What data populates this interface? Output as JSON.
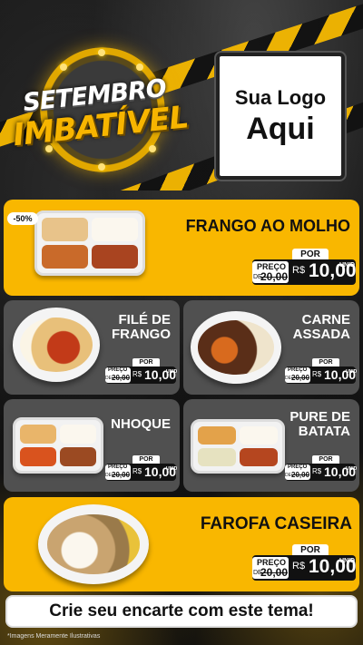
{
  "header": {
    "badge_line1": "SETEMBRO",
    "badge_line2": "IMBATÍVEL",
    "logo_line1": "Sua Logo",
    "logo_line2": "Aqui"
  },
  "price_common": {
    "por": "POR",
    "preco": "PREÇO",
    "de": "DE",
    "old": "20,00",
    "currency": "R$",
    "unid": "UNID"
  },
  "products": [
    {
      "name_lines": [
        "FRANGO AO MOLHO"
      ],
      "price": "10,00",
      "discount": "-50%"
    },
    {
      "name_lines": [
        "FILÉ DE",
        "FRANGO"
      ],
      "price": "10,00"
    },
    {
      "name_lines": [
        "CARNE",
        "ASSADA"
      ],
      "price": "10,00"
    },
    {
      "name_lines": [
        "NHOQUE"
      ],
      "price": "10,00"
    },
    {
      "name_lines": [
        "PURE DE",
        "BATATA"
      ],
      "price": "10,00"
    },
    {
      "name_lines": [
        "FAROFA CASEIRA"
      ],
      "price": "10,00"
    }
  ],
  "cta": "Crie seu encarte com este tema!",
  "footnote": "*Imagens Meramente Ilustrativas",
  "colors": {
    "accent": "#f9b700",
    "card_gray": "#505050",
    "background": "#141414"
  },
  "icons": [
    "food-tray-image",
    "food-bowl-image"
  ]
}
